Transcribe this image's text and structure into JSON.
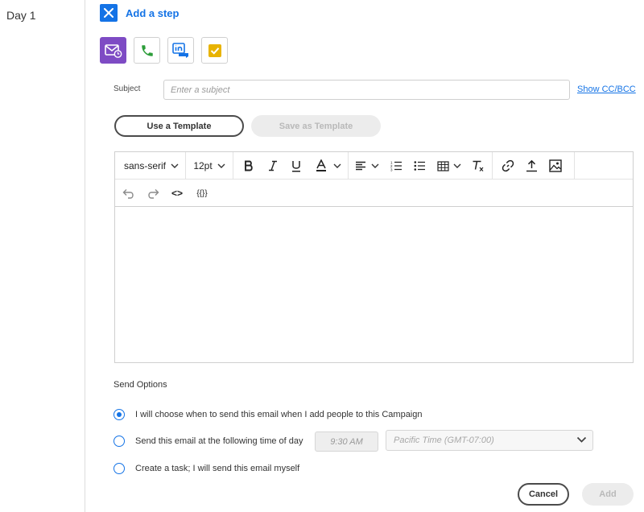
{
  "day": {
    "label": "Day 1"
  },
  "add_step": {
    "label": "Add a step"
  },
  "step_types": [
    {
      "name": "email",
      "icon": "mail-clock-icon",
      "selected": true
    },
    {
      "name": "call",
      "icon": "phone-icon",
      "selected": false
    },
    {
      "name": "linkedin",
      "icon": "linkedin-message-icon",
      "selected": false
    },
    {
      "name": "task",
      "icon": "checkbox-icon",
      "selected": false
    }
  ],
  "subject": {
    "label": "Subject",
    "placeholder": "Enter a subject",
    "value": ""
  },
  "show_cc_bcc": "Show CC/BCC",
  "template_buttons": {
    "use": "Use a Template",
    "save": "Save as Template"
  },
  "toolbar": {
    "font_family": "sans-serif",
    "font_size": "12pt",
    "code_label": "<>",
    "tokens_label": "{{}}"
  },
  "send_options": {
    "label": "Send Options",
    "options": [
      {
        "label": "I will choose when to send this email when I add people to this Campaign",
        "checked": true
      },
      {
        "label": "Send this email at the following time of day",
        "checked": false
      },
      {
        "label": "Create a task; I will send this email myself",
        "checked": false
      }
    ],
    "time": "9:30 AM",
    "timezone": "Pacific Time (GMT-07:00)"
  },
  "actions": {
    "cancel": "Cancel",
    "add": "Add"
  },
  "colors": {
    "accent": "#1473e6",
    "email_purple": "#7e4bc4",
    "phone_green": "#2d9d3a",
    "task_yellow": "#e8b300"
  }
}
